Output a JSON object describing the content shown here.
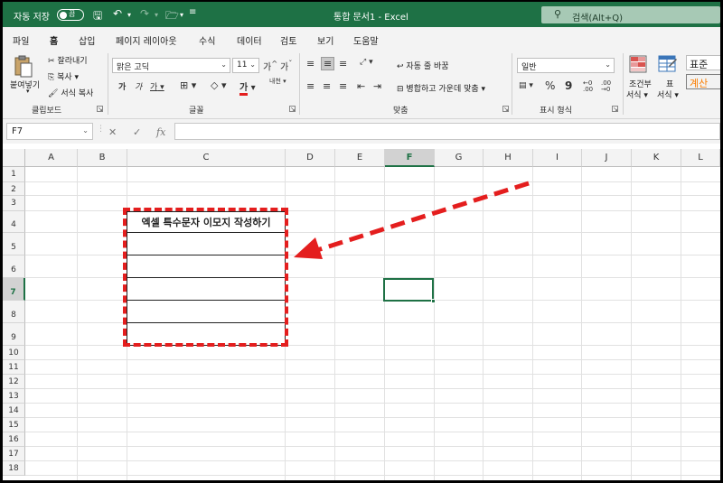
{
  "titlebar": {
    "autosave_label": "자동 저장",
    "autosave_state": "끔",
    "doc_title": "통합 문서1 - Excel",
    "search_placeholder": "검색(Alt+Q)"
  },
  "tabs": [
    "파일",
    "홈",
    "삽입",
    "페이지 레이아웃",
    "수식",
    "데이터",
    "검토",
    "보기",
    "도움말"
  ],
  "active_tab": "홈",
  "ribbon": {
    "clipboard": {
      "paste": "붙여넣기",
      "cut": "잘라내기",
      "copy": "복사",
      "format_painter": "서식 복사",
      "label": "클립보드"
    },
    "font": {
      "font_name": "맑은 고딕",
      "font_size": "11",
      "grow": "가",
      "shrink": "가",
      "bold": "가",
      "italic": "가",
      "underline": "가",
      "font_color_glyph": "가",
      "phonetic": "내천",
      "label": "글꼴"
    },
    "alignment": {
      "wrap_text": "자동 줄 바꿈",
      "merge_center": "병합하고 가운데 맞춤",
      "label": "맞춤"
    },
    "number": {
      "format": "일반",
      "percent": "%",
      "comma": "9",
      "inc_dec": "←0 .00",
      "dec_dec": ".00 →0",
      "label": "표시 형식"
    },
    "styles": {
      "conditional": "조건부",
      "conditional_2": "서식",
      "table": "표",
      "table_2": "서식",
      "style_normal": "표준",
      "style_calc": "계산"
    },
    "colors": {
      "normal_bg": "#ffffff",
      "calc_bg": "#f2f2f2",
      "calc_text": "#fa7d00"
    }
  },
  "formula_bar": {
    "name_box": "F7",
    "fx": "fx",
    "value": ""
  },
  "grid": {
    "columns": [
      "A",
      "B",
      "C",
      "D",
      "E",
      "F",
      "G",
      "H",
      "I",
      "J",
      "K",
      "L"
    ],
    "rows": [
      "1",
      "2",
      "3",
      "4",
      "5",
      "6",
      "7",
      "8",
      "9",
      "10",
      "11",
      "12",
      "13",
      "14",
      "15",
      "16",
      "17",
      "18"
    ],
    "selected_cell": "F7",
    "table_header": "엑셀 특수문자 이모지 작성하기"
  },
  "colors": {
    "accent": "#1e7145",
    "annotation": "#e41e1e"
  }
}
